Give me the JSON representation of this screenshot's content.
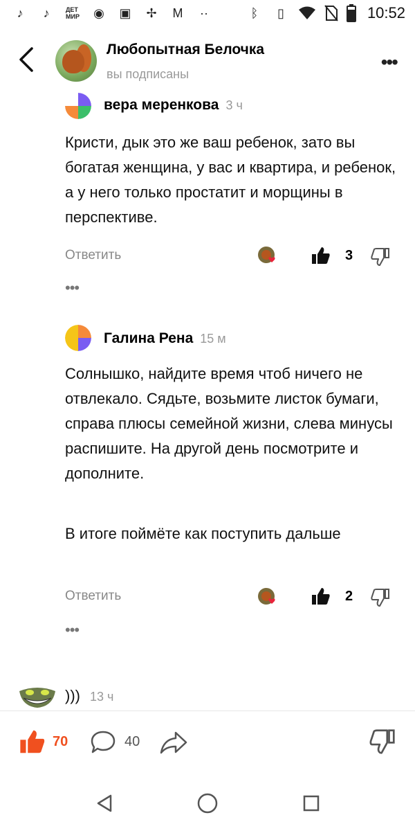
{
  "status_bar": {
    "time": "10:52",
    "left_icons": [
      "tiktok-icon",
      "tiktok-icon",
      "detmir-icon",
      "app-icon",
      "frog-icon",
      "pinwheel-icon",
      "gmail-icon"
    ],
    "right_icons": [
      "bluetooth-icon",
      "vibrate-icon",
      "wifi-icon",
      "no-sim-icon",
      "battery-icon"
    ]
  },
  "header": {
    "title": "Любопытная Белочка",
    "subtitle": "вы подписаны"
  },
  "comments": [
    {
      "author": "вера меренкова",
      "time": "3 ч",
      "text": "Кристи, дык это же ваш ребенок, зато вы богатая женщина, у вас и квартира, и ребенок, а у него только простатит и морщины в перспективе.",
      "reply_label": "Ответить",
      "likes": "3"
    },
    {
      "author": "Галина Рена",
      "time": "15 м",
      "text": "Солнышко, найдите время чтоб ничего не отвлекало. Сядьте, возьмите листок бумаги, справа плюсы семейной жизни, слева минусы распишите. На другой день посмотрите и дополните.",
      "text2": "В итоге поймёте как поступить дальше",
      "reply_label": "Ответить",
      "likes": "2"
    }
  ],
  "more_dots": "•••",
  "next_comment": {
    "text": ")))",
    "time": "13 ч"
  },
  "bottom_bar": {
    "likes": "70",
    "comments": "40"
  },
  "colors": {
    "accent": "#f0501f",
    "muted": "#999999"
  }
}
